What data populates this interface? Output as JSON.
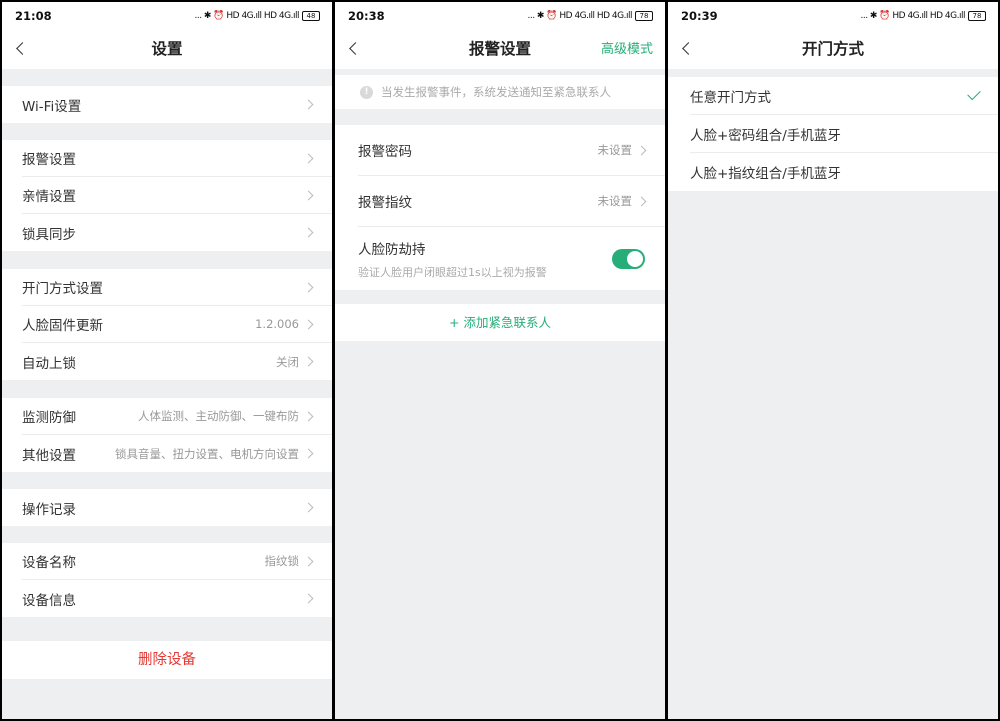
{
  "status": {
    "left_time": "21:08",
    "mid_time": "20:38",
    "right_time": "20:39",
    "icons_text": "... ✱ ⏰ HD 4G.ıll HD 4G.ıll",
    "battery_left": "48",
    "battery_mid": "78",
    "battery_right": "78"
  },
  "settings": {
    "title": "设置",
    "groups": [
      [
        {
          "label": "Wi-Fi设置",
          "value": ""
        }
      ],
      [
        {
          "label": "报警设置",
          "value": ""
        },
        {
          "label": "亲情设置",
          "value": ""
        },
        {
          "label": "锁具同步",
          "value": ""
        }
      ],
      [
        {
          "label": "开门方式设置",
          "value": ""
        },
        {
          "label": "人脸固件更新",
          "value": "1.2.006"
        },
        {
          "label": "自动上锁",
          "value": "关闭"
        }
      ],
      [
        {
          "label": "监测防御",
          "value": "人体监测、主动防御、一键布防"
        },
        {
          "label": "其他设置",
          "value": "锁具音量、扭力设置、电机方向设置"
        }
      ],
      [
        {
          "label": "操作记录",
          "value": ""
        }
      ],
      [
        {
          "label": "设备名称",
          "value": "指纹锁"
        },
        {
          "label": "设备信息",
          "value": ""
        }
      ]
    ],
    "delete_label": "删除设备"
  },
  "alarm": {
    "title": "报警设置",
    "action": "高级模式",
    "notice": "当发生报警事件，系统发送通知至紧急联系人",
    "rows": [
      {
        "label": "报警密码",
        "value": "未设置"
      },
      {
        "label": "报警指纹",
        "value": "未设置"
      }
    ],
    "face_label": "人脸防劫持",
    "face_sub": "验证人脸用户闭眼超过1s以上视为报警",
    "face_enabled": true,
    "add_contact": "+ 添加紧急联系人"
  },
  "unlock": {
    "title": "开门方式",
    "options": [
      {
        "label": "任意开门方式",
        "selected": true
      },
      {
        "label": "人脸+密码组合/手机蓝牙",
        "selected": false
      },
      {
        "label": "人脸+指纹组合/手机蓝牙",
        "selected": false
      }
    ]
  },
  "colors": {
    "accent": "#27ae78",
    "danger": "#e53935",
    "background": "#eeeff1"
  }
}
